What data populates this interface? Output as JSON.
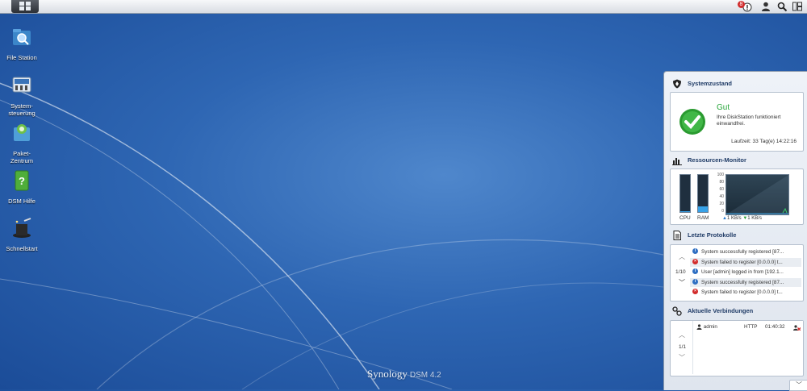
{
  "desktop": {
    "icons": [
      {
        "label": "File Station"
      },
      {
        "label": "System-\nsteuerung"
      },
      {
        "label": "Paket-\nZentrum"
      },
      {
        "label": "DSM Hilfe"
      },
      {
        "label": "Schnellstart"
      }
    ],
    "brand": {
      "name": "Synology",
      "version": "DSM 4.2"
    }
  },
  "topbar": {
    "notification_count": "8",
    "icons": [
      "notification-icon",
      "user-icon",
      "search-icon",
      "widgets-icon"
    ]
  },
  "panel": {
    "health": {
      "title": "Systemzustand",
      "status": "Gut",
      "description": "Ihre DiskStation funktioniert einwandfrei.",
      "uptime": "Laufzeit: 33 Tag(e) 14:22:16",
      "color": "#27a63a"
    },
    "resource": {
      "title": "Ressourcen-Monitor",
      "cpu_label": "CPU",
      "ram_label": "RAM",
      "cpu_percent": 2,
      "ram_percent": 15,
      "y_ticks": [
        "100",
        "80",
        "60",
        "40",
        "20",
        "0"
      ],
      "upload": "1 KB/s",
      "download": "1 KB/s"
    },
    "logs": {
      "title": "Letzte Protokolle",
      "page": "1/10",
      "rows": [
        {
          "type": "info",
          "text": "System successfully registered [87..."
        },
        {
          "type": "error",
          "text": "System failed to register [0.0.0.0] t..."
        },
        {
          "type": "info",
          "text": "User [admin] logged in from [192.1..."
        },
        {
          "type": "info",
          "text": "System successfully registered [87..."
        },
        {
          "type": "error",
          "text": "System failed to register [0.0.0.0] t..."
        }
      ]
    },
    "connections": {
      "title": "Aktuelle Verbindungen",
      "page": "1/1",
      "rows": [
        {
          "user": "admin",
          "protocol": "HTTP",
          "time": "01:40:32"
        }
      ]
    }
  }
}
